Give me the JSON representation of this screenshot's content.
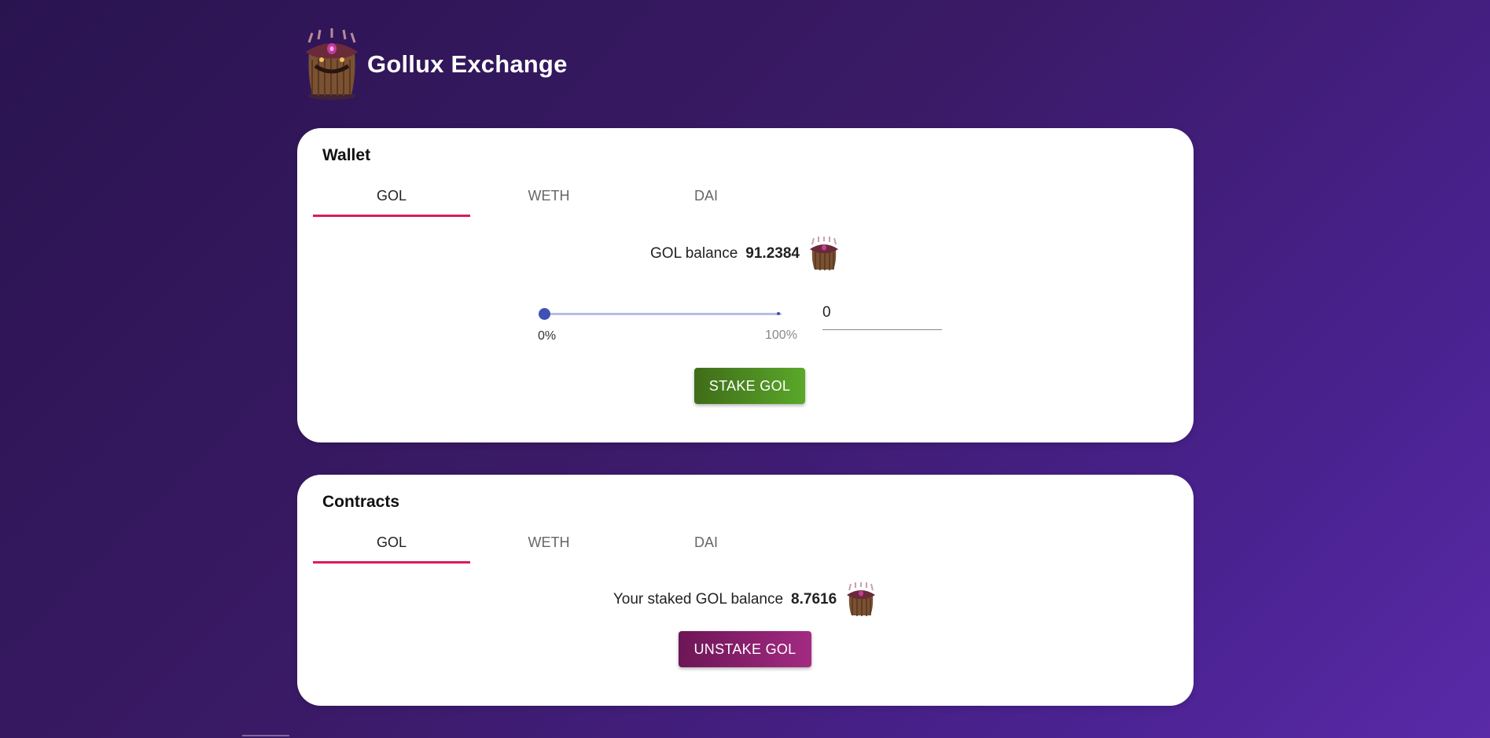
{
  "app": {
    "title": "Gollux Exchange",
    "logo_icon": "gollux-monster-icon"
  },
  "wallet": {
    "title": "Wallet",
    "tabs": [
      {
        "label": "GOL",
        "active": true
      },
      {
        "label": "WETH",
        "active": false
      },
      {
        "label": "DAI",
        "active": false
      }
    ],
    "balance_label": "GOL balance",
    "balance_value": "91.2384",
    "slider": {
      "min_label": "0%",
      "max_label": "100%",
      "value_percent": 0
    },
    "amount_value": "0",
    "stake_button": "STAKE GOL"
  },
  "contracts": {
    "title": "Contracts",
    "tabs": [
      {
        "label": "GOL",
        "active": true
      },
      {
        "label": "WETH",
        "active": false
      },
      {
        "label": "DAI",
        "active": false
      }
    ],
    "balance_label": "Your staked GOL balance",
    "balance_value": "8.7616",
    "unstake_button": "UNSTAKE GOL"
  },
  "colors": {
    "accent_tab": "#d81b60",
    "slider": "#3f51b5",
    "stake_button": "#4e8f22",
    "unstake_button": "#8a2070"
  }
}
